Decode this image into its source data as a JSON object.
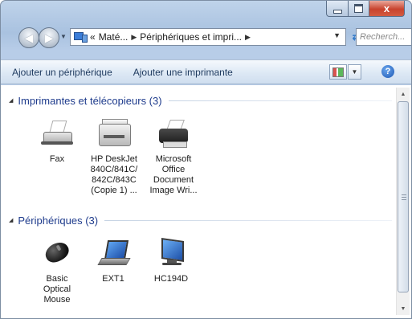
{
  "window": {
    "caption": {
      "close_label": "x"
    }
  },
  "address_bar": {
    "prefix": "«",
    "crumbs": [
      "Maté...",
      "Périphériques et impri..."
    ],
    "search_placeholder": "Recherch..."
  },
  "command_bar": {
    "add_device": "Ajouter un périphérique",
    "add_printer": "Ajouter une imprimante",
    "help_label": "?"
  },
  "sections": {
    "printers": {
      "title": "Imprimantes et télécopieurs (3)",
      "items": [
        {
          "name": "Fax",
          "icon": "fax-icon"
        },
        {
          "name": "HP DeskJet 840C/841C/ 842C/843C (Copie 1) ...",
          "icon": "printer-icon"
        },
        {
          "name": "Microsoft Office Document Image Wri...",
          "icon": "printer-icon"
        }
      ]
    },
    "devices": {
      "title": "Périphériques (3)",
      "items": [
        {
          "name": "Basic Optical Mouse",
          "icon": "mouse-icon"
        },
        {
          "name": "EXT1",
          "icon": "laptop-icon"
        },
        {
          "name": "HC194D",
          "icon": "monitor-icon"
        }
      ]
    }
  },
  "colors": {
    "section_title": "#1e3b8c",
    "command_text": "#1e3a5f",
    "close_button": "#c8432e"
  }
}
